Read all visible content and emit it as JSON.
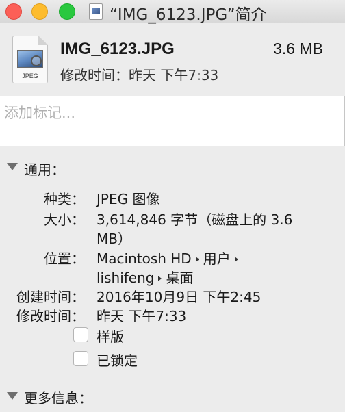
{
  "window": {
    "title": "“IMG_6123.JPG”简介"
  },
  "header": {
    "file_name": "IMG_6123.JPG",
    "file_size": "3.6 MB",
    "modified": "修改时间：昨天 下午7:33",
    "icon_label": "JPEG"
  },
  "tags": {
    "placeholder": "添加标记..."
  },
  "general": {
    "title": "通用：",
    "kind_label": "种类：",
    "kind_value": "JPEG 图像",
    "size_label": "大小：",
    "size_value_line1": "3,614,846 字节（磁盘上的 3.6",
    "size_value_line2": "MB）",
    "where_label": "位置：",
    "where_path": [
      "Macintosh HD",
      "用户",
      "lishifeng",
      "桌面"
    ],
    "created_label": "创建时间：",
    "created_value": "2016年10月9日 下午2:45",
    "modified_label": "修改时间：",
    "modified_value": "昨天 下午7:33",
    "stationery_label": "样版",
    "locked_label": "已锁定"
  },
  "more_info": {
    "title": "更多信息："
  }
}
